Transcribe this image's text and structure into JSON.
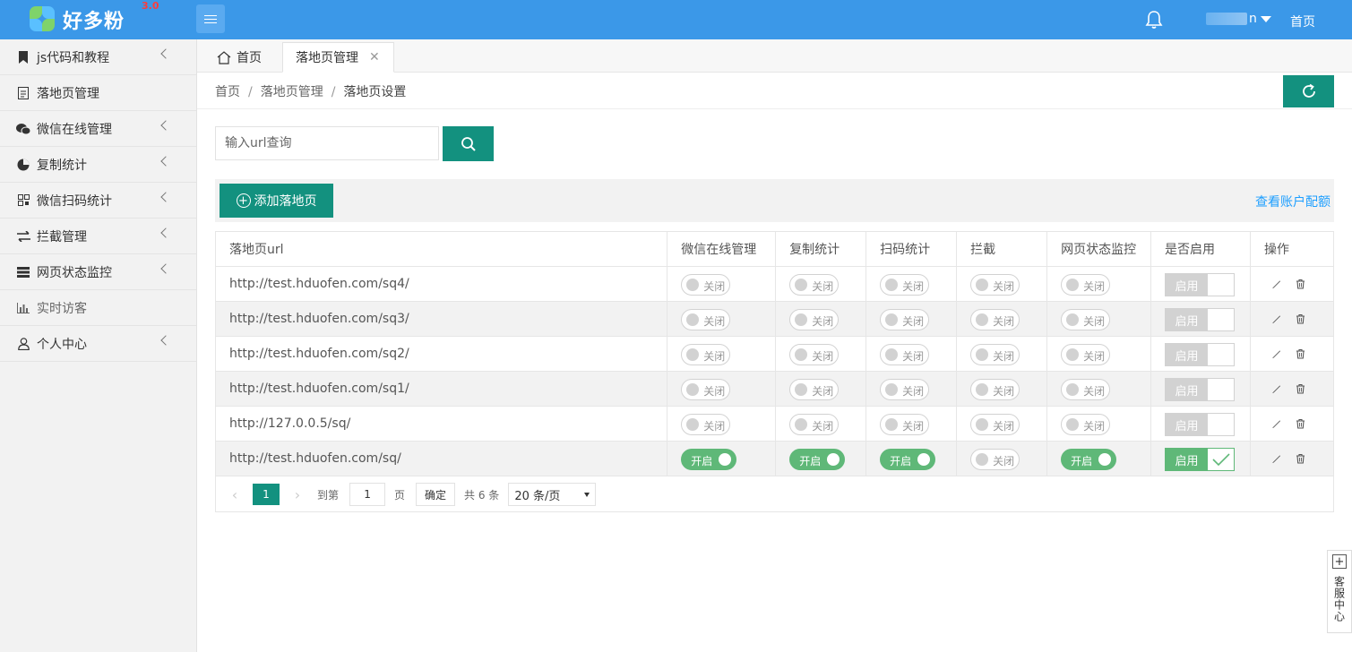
{
  "header": {
    "logo_text": "好多粉",
    "logo_version": "3.0",
    "user_name": "n",
    "home_link": "首页",
    "menu_toggle_icon": "hamburger-icon",
    "bell_icon": "bell-icon",
    "bg_color": "#3b98e8"
  },
  "sidebar": {
    "items": [
      {
        "label": "js代码和教程",
        "icon": "bookmark-icon",
        "expandable": true
      },
      {
        "label": "落地页管理",
        "icon": "document-icon",
        "expandable": false
      },
      {
        "label": "微信在线管理",
        "icon": "wechat-icon",
        "expandable": true
      },
      {
        "label": "复制统计",
        "icon": "pie-chart-icon",
        "expandable": true
      },
      {
        "label": "微信扫码统计",
        "icon": "qrcode-icon",
        "expandable": true
      },
      {
        "label": "拦截管理",
        "icon": "exchange-icon",
        "expandable": true
      },
      {
        "label": "网页状态监控",
        "icon": "server-icon",
        "expandable": true
      },
      {
        "label": "实时访客",
        "icon": "bar-chart-icon",
        "expandable": false
      },
      {
        "label": "个人中心",
        "icon": "user-icon",
        "expandable": true
      }
    ]
  },
  "tabs": {
    "home": "首页",
    "active": "落地页管理"
  },
  "breadcrumb": [
    "首页",
    "落地页管理",
    "落地页设置"
  ],
  "search": {
    "placeholder": "输入url查询",
    "value": ""
  },
  "toolbar": {
    "add_label": "添加落地页",
    "quota_link": "查看账户配额"
  },
  "table": {
    "columns": [
      "落地页url",
      "微信在线管理",
      "复制统计",
      "扫码统计",
      "拦截",
      "网页状态监控",
      "是否启用",
      "操作"
    ],
    "rows": [
      {
        "url": "http://test.hduofen.com/sq4/",
        "wechat": "关闭",
        "copy": "关闭",
        "scan": "关闭",
        "block": "关闭",
        "monitor": "关闭",
        "enabled": "启用",
        "enabled_on": false
      },
      {
        "url": "http://test.hduofen.com/sq3/",
        "wechat": "关闭",
        "copy": "关闭",
        "scan": "关闭",
        "block": "关闭",
        "monitor": "关闭",
        "enabled": "启用",
        "enabled_on": false
      },
      {
        "url": "http://test.hduofen.com/sq2/",
        "wechat": "关闭",
        "copy": "关闭",
        "scan": "关闭",
        "block": "关闭",
        "monitor": "关闭",
        "enabled": "启用",
        "enabled_on": false
      },
      {
        "url": "http://test.hduofen.com/sq1/",
        "wechat": "关闭",
        "copy": "关闭",
        "scan": "关闭",
        "block": "关闭",
        "monitor": "关闭",
        "enabled": "启用",
        "enabled_on": false
      },
      {
        "url": "http://127.0.0.5/sq/",
        "wechat": "关闭",
        "copy": "关闭",
        "scan": "关闭",
        "block": "关闭",
        "monitor": "关闭",
        "enabled": "启用",
        "enabled_on": false
      },
      {
        "url": "http://test.hduofen.com/sq/",
        "wechat": "开启",
        "copy": "开启",
        "scan": "开启",
        "block": "关闭",
        "monitor": "开启",
        "enabled": "启用",
        "enabled_on": true
      }
    ]
  },
  "pager": {
    "current_page": "1",
    "goto_label": "到第",
    "goto_value": "1",
    "page_unit": "页",
    "confirm": "确定",
    "total": "共 6 条",
    "page_size": "20 条/页"
  },
  "service_widget": {
    "label": "客服中心"
  },
  "colors": {
    "primary": "#13917f",
    "switch_on": "#5fb878",
    "link": "#1e9fff"
  }
}
